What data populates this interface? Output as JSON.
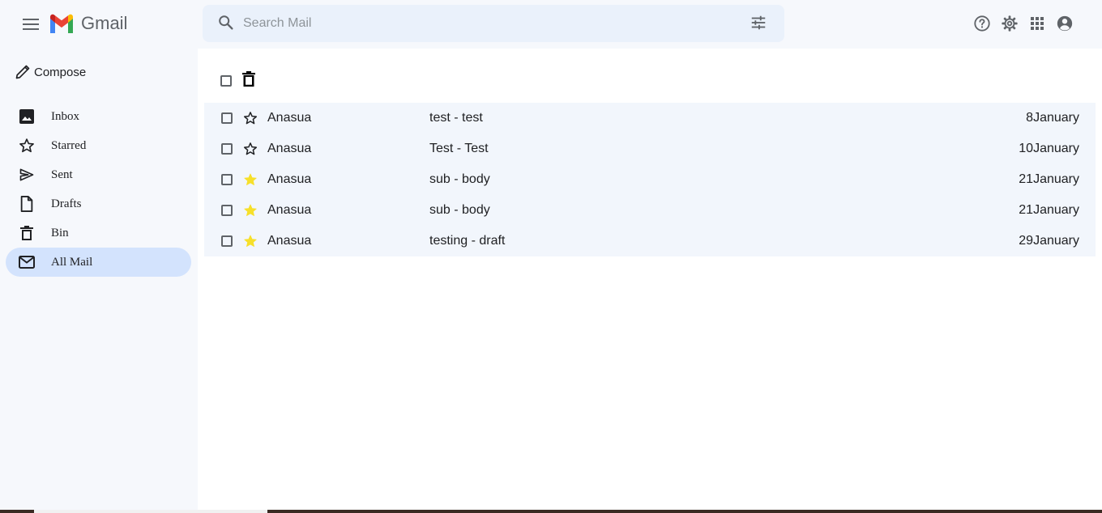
{
  "app": {
    "name": "Gmail"
  },
  "search": {
    "placeholder": "Search Mail"
  },
  "sidebar": {
    "compose_label": "Compose",
    "items": [
      {
        "label": "Inbox",
        "icon": "image-icon",
        "active": false
      },
      {
        "label": "Starred",
        "icon": "star-outline-icon",
        "active": false
      },
      {
        "label": "Sent",
        "icon": "send-icon",
        "active": false
      },
      {
        "label": "Drafts",
        "icon": "file-icon",
        "active": false
      },
      {
        "label": "Bin",
        "icon": "trash-icon",
        "active": false
      },
      {
        "label": "All Mail",
        "icon": "mail-icon",
        "active": true
      }
    ]
  },
  "header_icons": [
    "help-icon",
    "settings-icon",
    "apps-grid-icon",
    "account-icon"
  ],
  "colors": {
    "accent": "#d3e3fd",
    "star_filled": "#f7e02a",
    "search_bg": "#eaf1fb",
    "row_bg": "#f2f6fc"
  },
  "mails": [
    {
      "sender": "Anasua",
      "subject": "test - test",
      "date": "8January",
      "starred": false
    },
    {
      "sender": "Anasua",
      "subject": "Test - Test",
      "date": "10January",
      "starred": false
    },
    {
      "sender": "Anasua",
      "subject": "sub - body",
      "date": "21January",
      "starred": true
    },
    {
      "sender": "Anasua",
      "subject": "sub - body",
      "date": "21January",
      "starred": true
    },
    {
      "sender": "Anasua",
      "subject": "testing - draft",
      "date": "29January",
      "starred": true
    }
  ]
}
